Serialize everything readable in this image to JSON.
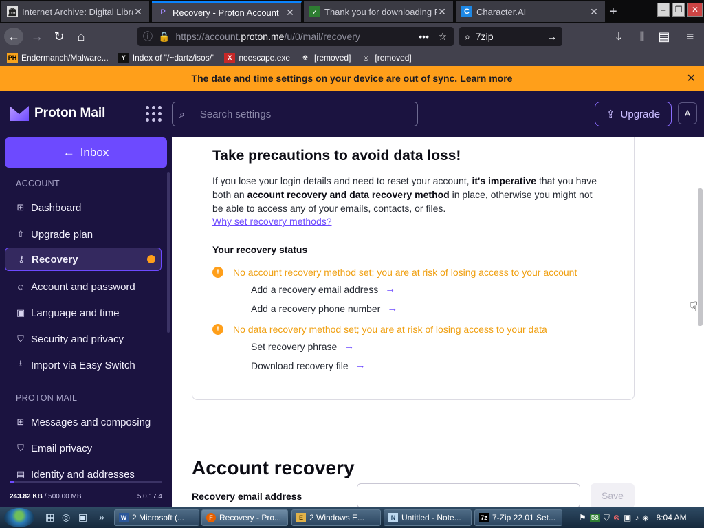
{
  "browser": {
    "tabs": [
      {
        "title": "Internet Archive: Digital Libra",
        "icon": "archive-icon"
      },
      {
        "title": "Recovery - Proton Account",
        "icon": "proton-icon",
        "active": true
      },
      {
        "title": "Thank you for downloading F",
        "icon": "download-page-icon"
      },
      {
        "title": "Character.AI",
        "icon": "character-ai-icon"
      }
    ],
    "new_tab": "+",
    "url": {
      "prefix": "https://account.",
      "host": "proton.me",
      "path": "/u/0/mail/recovery"
    },
    "search_value": "7zip",
    "bookmarks": [
      {
        "label": "Endermanch/Malware...",
        "icon": "PH"
      },
      {
        "label": "Index of \"/~dartz/isos/\"",
        "icon": "Y"
      },
      {
        "label": "noescape.exe",
        "icon": "X"
      },
      {
        "label": "[removed]",
        "icon": "☢"
      },
      {
        "label": "[removed]",
        "icon": "◎"
      }
    ]
  },
  "notice": {
    "text": "The date and time settings on your device are out of sync.",
    "link": "Learn more"
  },
  "header": {
    "app_name": "Proton Mail",
    "search_placeholder": "Search settings",
    "upgrade_label": "Upgrade",
    "avatar_initial": "A"
  },
  "sidebar": {
    "inbox_label": "Inbox",
    "account_title": "ACCOUNT",
    "account_items": [
      {
        "label": "Dashboard",
        "icon": "dashboard-icon"
      },
      {
        "label": "Upgrade plan",
        "icon": "upgrade-icon"
      },
      {
        "label": "Recovery",
        "icon": "key-icon",
        "active": true
      },
      {
        "label": "Account and password",
        "icon": "user-icon"
      },
      {
        "label": "Language and time",
        "icon": "language-icon"
      },
      {
        "label": "Security and privacy",
        "icon": "shield-icon"
      },
      {
        "label": "Import via Easy Switch",
        "icon": "import-icon"
      }
    ],
    "mail_title": "PROTON MAIL",
    "mail_items": [
      {
        "label": "Messages and composing",
        "icon": "grid-icon"
      },
      {
        "label": "Email privacy",
        "icon": "shield-icon"
      },
      {
        "label": "Identity and addresses",
        "icon": "id-card-icon"
      }
    ],
    "storage_used": "243.82 KB",
    "storage_total": "/ 500.00 MB",
    "storage_fraction": 0.0005,
    "version": "5.0.17.4"
  },
  "main": {
    "card_title": "Take precautions to avoid data loss!",
    "para_1": "If you lose your login details and need to reset your account,",
    "para_bold_1": "it's imperative",
    "para_2": "that you have both an",
    "para_bold_2": "account recovery and data recovery method",
    "para_3": "in place, otherwise you might not be able to access any of your emails, contacts, or files.",
    "why_link": "Why set recovery methods?",
    "status_title": "Your recovery status",
    "warning_account": "No account recovery method set; you are at risk of losing access to your account",
    "link_email": "Add a recovery email address",
    "link_phone": "Add a recovery phone number",
    "warning_data": "No data recovery method set; you are at risk of losing access to your data",
    "link_phrase": "Set recovery phrase",
    "link_file": "Download recovery file",
    "section_title": "Account recovery",
    "email_label": "Recovery email address",
    "email_value": "",
    "save_label": "Save"
  },
  "taskbar": {
    "buttons": [
      {
        "label": "2 Microsoft (...",
        "icon": "W"
      },
      {
        "label": "Recovery - Pro...",
        "icon": "F",
        "active": true
      },
      {
        "label": "2 Windows E...",
        "icon": "E"
      },
      {
        "label": "Untitled - Note...",
        "icon": "N"
      },
      {
        "label": "7-Zip 22.01 Set...",
        "icon": "7z"
      }
    ],
    "tray_badge": "58",
    "clock": "8:04 AM"
  },
  "colors": {
    "accent": "#6d4aff",
    "warning": "#ff9f1a",
    "sidebar_bg": "#1b1340"
  }
}
